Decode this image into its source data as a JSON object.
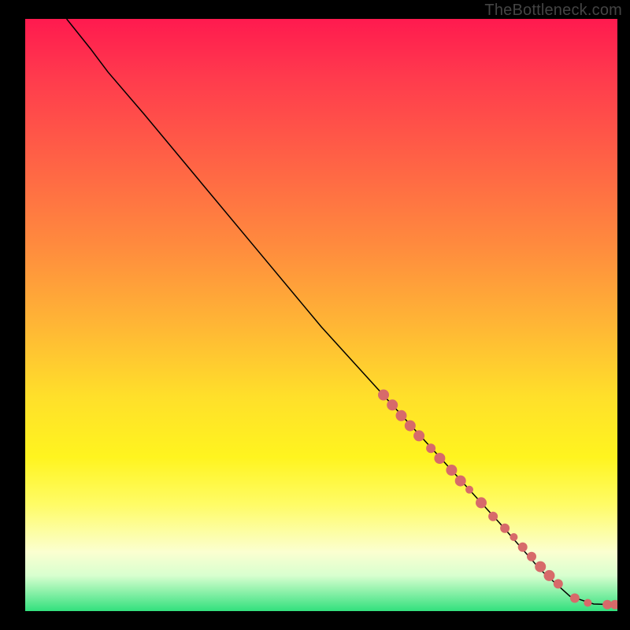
{
  "watermark": "TheBottleneck.com",
  "chart_data": {
    "type": "line",
    "title": "",
    "xlabel": "",
    "ylabel": "",
    "xlim": [
      0,
      100
    ],
    "ylim": [
      0,
      100
    ],
    "grid": false,
    "curve": [
      {
        "x": 7,
        "y": 100
      },
      {
        "x": 11,
        "y": 95
      },
      {
        "x": 14,
        "y": 91
      },
      {
        "x": 20,
        "y": 84
      },
      {
        "x": 30,
        "y": 72
      },
      {
        "x": 40,
        "y": 60
      },
      {
        "x": 50,
        "y": 48
      },
      {
        "x": 60,
        "y": 37
      },
      {
        "x": 70,
        "y": 26
      },
      {
        "x": 80,
        "y": 15
      },
      {
        "x": 87,
        "y": 7
      },
      {
        "x": 92,
        "y": 2.5
      },
      {
        "x": 96,
        "y": 1.2
      },
      {
        "x": 99.5,
        "y": 1.1
      }
    ],
    "series": [
      {
        "name": "markers",
        "color": "#d76a6a",
        "points": [
          {
            "x": 60.5,
            "y": 36.5,
            "r": 7
          },
          {
            "x": 62.0,
            "y": 34.8,
            "r": 7
          },
          {
            "x": 63.5,
            "y": 33.0,
            "r": 7
          },
          {
            "x": 65.0,
            "y": 31.3,
            "r": 7
          },
          {
            "x": 66.5,
            "y": 29.6,
            "r": 7
          },
          {
            "x": 68.5,
            "y": 27.5,
            "r": 6
          },
          {
            "x": 70.0,
            "y": 25.8,
            "r": 7
          },
          {
            "x": 72.0,
            "y": 23.8,
            "r": 7
          },
          {
            "x": 73.5,
            "y": 22.0,
            "r": 7
          },
          {
            "x": 75.0,
            "y": 20.5,
            "r": 5
          },
          {
            "x": 77.0,
            "y": 18.3,
            "r": 7
          },
          {
            "x": 79.0,
            "y": 16.0,
            "r": 6
          },
          {
            "x": 81.0,
            "y": 14.0,
            "r": 6
          },
          {
            "x": 82.5,
            "y": 12.5,
            "r": 5
          },
          {
            "x": 84.0,
            "y": 10.8,
            "r": 6
          },
          {
            "x": 85.5,
            "y": 9.2,
            "r": 6
          },
          {
            "x": 87.0,
            "y": 7.5,
            "r": 7
          },
          {
            "x": 88.5,
            "y": 6.0,
            "r": 7
          },
          {
            "x": 90.0,
            "y": 4.6,
            "r": 6
          },
          {
            "x": 92.8,
            "y": 2.2,
            "r": 6
          },
          {
            "x": 95.0,
            "y": 1.4,
            "r": 5
          },
          {
            "x": 98.3,
            "y": 1.1,
            "r": 6
          },
          {
            "x": 99.6,
            "y": 1.1,
            "r": 6
          }
        ]
      }
    ]
  }
}
